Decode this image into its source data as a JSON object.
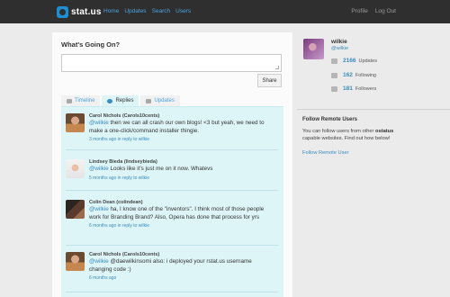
{
  "app": {
    "logo_text": "stat.us"
  },
  "nav": {
    "home": "Home",
    "updates": "Updates",
    "search": "Search",
    "users": "Users"
  },
  "nav_right": {
    "profile": "Profile",
    "logout": "Log Out"
  },
  "composer": {
    "heading": "What's Going On?",
    "placeholder": "",
    "share_label": "Share"
  },
  "tabs": [
    {
      "label": "Timeline",
      "icon": "list-icon"
    },
    {
      "label": "Replies",
      "icon": "reply-icon"
    },
    {
      "label": "Updates",
      "icon": "chat-icon"
    }
  ],
  "notices": [
    {
      "author": "Carol Nichols (Carols10cents)",
      "mention": "@wilkie",
      "text": " then we can all crash our own blogs! <3 but yeah, we need to make a one-click/command installer thingie.",
      "meta": "3 months ago in reply to wilkie"
    },
    {
      "author": "Lindsey Bieda (lindseybieda)",
      "mention": "@wilkie",
      "text": " Looks like it's just me on it now. Whatevs",
      "meta": "5 months ago in reply to wilkie"
    },
    {
      "author": "Colin Dean (colindean)",
      "mention": "@wilkie",
      "text": " ha, I know one of the \"inventors\". I think most of those people work for Branding Brand? Also, Opera has done that process for yrs",
      "meta": "6 months ago in reply to wilkie"
    },
    {
      "author": "Carol Nichols (Carols10cents)",
      "mention": "@wilkie",
      "text": " @daewilkinsomi also: i deployed your rstat.us username changing code :)",
      "meta": "6 months ago"
    }
  ],
  "profile": {
    "name": "wilkie",
    "handle": "@wilkie",
    "stats": [
      {
        "value": "2166",
        "label": "Updates",
        "icon": "chat-icon"
      },
      {
        "value": "162",
        "label": "Following",
        "icon": "following-icon"
      },
      {
        "value": "181",
        "label": "Followers",
        "icon": "followers-icon"
      }
    ]
  },
  "remote": {
    "title": "Follow Remote Users",
    "text_before": "You can follow users from other ",
    "text_bold": "ostatus",
    "text_after": " capable websites. Find out how below!",
    "link": "Follow Remote User"
  }
}
